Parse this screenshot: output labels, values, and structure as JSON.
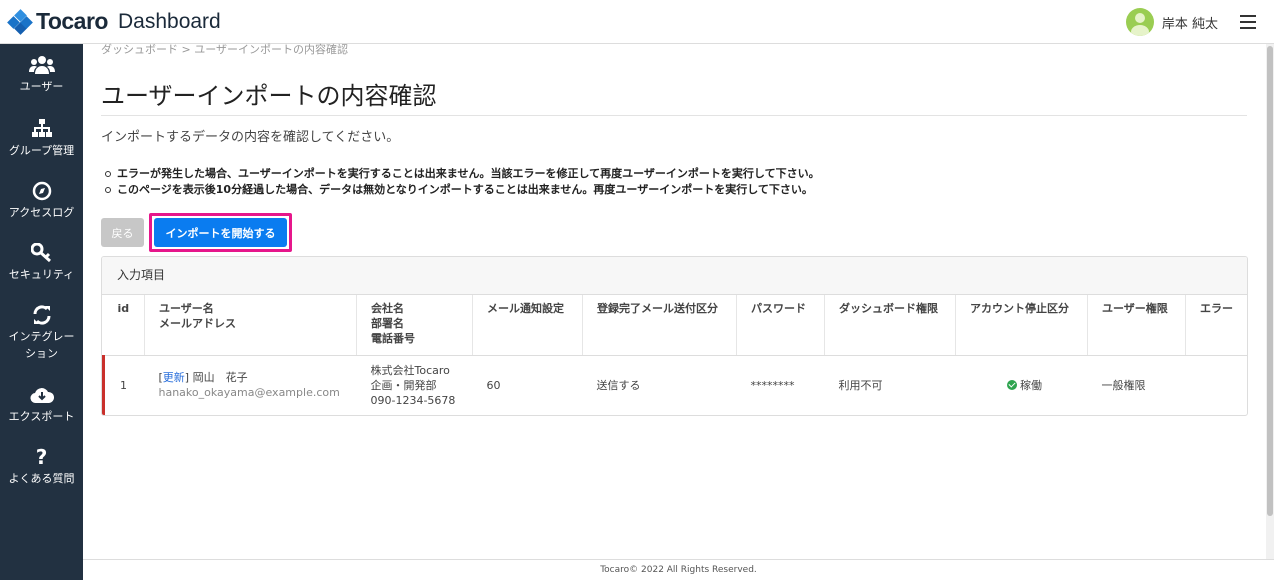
{
  "header": {
    "logo_text": "Tocaro",
    "app_title": "Dashboard",
    "user_name": "岸本 純太"
  },
  "sidebar": {
    "items": [
      {
        "label": "ユーザー",
        "icon": "users-icon"
      },
      {
        "label": "グループ管理",
        "icon": "org-chart-icon"
      },
      {
        "label": "アクセスログ",
        "icon": "compass-icon"
      },
      {
        "label": "セキュリティ",
        "icon": "key-icon"
      },
      {
        "label": "インテグレーション",
        "icon": "sync-icon"
      },
      {
        "label": "エクスポート",
        "icon": "cloud-download-icon"
      },
      {
        "label": "よくある質問",
        "icon": "question-icon"
      }
    ]
  },
  "breadcrumb": "ダッシュボード > ユーザーインポートの内容確認",
  "page_title": "ユーザーインポートの内容確認",
  "lead": "インポートするデータの内容を確認してください。",
  "notes": [
    "エラーが発生した場合、ユーザーインポートを実行することは出来ません。当該エラーを修正して再度ユーザーインポートを実行して下さい。",
    "このページを表示後10分経過した場合、データは無効となりインポートすることは出来ません。再度ユーザーインポートを実行して下さい。"
  ],
  "buttons": {
    "back": "戻る",
    "start": "インポートを開始する"
  },
  "table": {
    "title": "入力項目",
    "columns": {
      "id": "id",
      "user_name": "ユーザー名",
      "email": "メールアドレス",
      "company": "会社名",
      "department": "部署名",
      "phone": "電話番号",
      "mail_notify": "メール通知設定",
      "reg_mail": "登録完了メール送付区分",
      "password": "パスワード",
      "dashboard": "ダッシュボード権限",
      "suspend": "アカウント停止区分",
      "role": "ユーザー権限",
      "error": "エラー"
    },
    "rows": [
      {
        "id": "1",
        "tag": "更新",
        "name": "岡山　花子",
        "email": "hanako_okayama@example.com",
        "company": "株式会社Tocaro",
        "department": "企画・開発部",
        "phone": "090-1234-5678",
        "mail_notify": "60",
        "reg_mail": "送信する",
        "password": "********",
        "dashboard": "利用不可",
        "suspend": "稼働",
        "role": "一般権限",
        "error": ""
      }
    ]
  },
  "footer": "Tocaro© 2022 All Rights Reserved.",
  "colors": {
    "sidebar_bg": "#223141",
    "primary_button": "#0a7cf0",
    "highlight_border": "#e6168b",
    "error_bar": "#c9302c"
  }
}
